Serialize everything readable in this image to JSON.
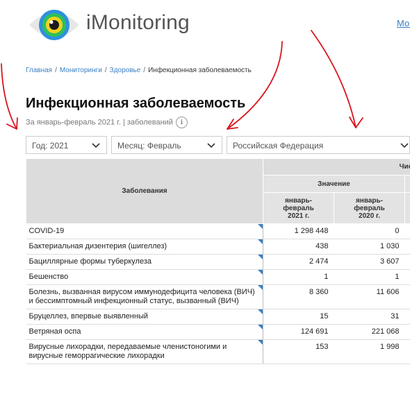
{
  "header": {
    "brand": "iMonitoring",
    "top_link": "Мон"
  },
  "breadcrumb": {
    "items": [
      "Главная",
      "Мониторинги",
      "Здоровье"
    ],
    "current": "Инфекционная заболеваемость"
  },
  "page": {
    "title": "Инфекционная заболеваемость",
    "subtitle": "За январь-февраль 2021 г. | заболеваний"
  },
  "filters": {
    "year": "Год: 2021",
    "month": "Месяц: Февраль",
    "region": "Российская  Федерация"
  },
  "table": {
    "header_diseases": "Заболевания",
    "header_cases": "Число случа",
    "header_value": "Значение",
    "col_2021": "январь-февраль 2021 г.",
    "col_2020": "январь-февраль 2020 г.",
    "rows": [
      {
        "name": "COVID-19",
        "v2021": "1 298 448",
        "v2020": "0"
      },
      {
        "name": "Бактериальная дизентерия (шигеллез)",
        "v2021": "438",
        "v2020": "1 030"
      },
      {
        "name": "Бациллярные формы туберкулеза",
        "v2021": "2 474",
        "v2020": "3 607"
      },
      {
        "name": "Бешенство",
        "v2021": "1",
        "v2020": "1"
      },
      {
        "name": "Болезнь, вызванная вирусом иммунодефицита человека (ВИЧ) и бессимптомный инфекционный статус, вызванный (ВИЧ)",
        "v2021": "8 360",
        "v2020": "11 606"
      },
      {
        "name": "Бруцеллез, впервые выявленный",
        "v2021": "15",
        "v2020": "31"
      },
      {
        "name": "Ветряная оспа",
        "v2021": "124 691",
        "v2020": "221 068"
      },
      {
        "name": "Вирусные лихорадки, передаваемые членистоногими и вирусные геморрагические лихорадки",
        "v2021": "153",
        "v2020": "1 998"
      }
    ]
  },
  "colors": {
    "accent": "#3a7fc4",
    "annotation": "#d9141b",
    "header_bg": "#dcdcdc"
  }
}
